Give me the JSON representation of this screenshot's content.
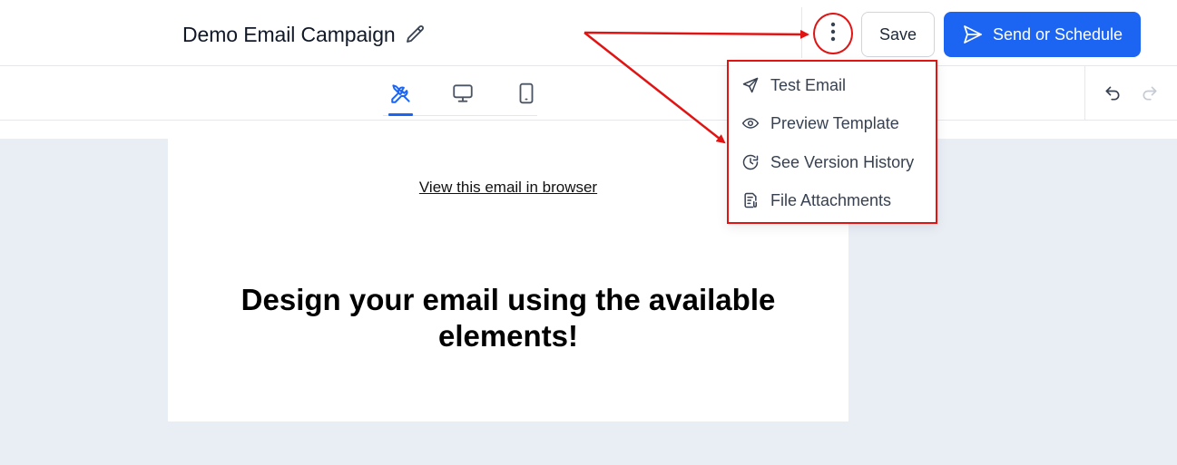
{
  "header": {
    "campaign_title": "Demo Email Campaign",
    "save_label": "Save",
    "send_label": "Send or Schedule",
    "accent_color": "#1c64f2"
  },
  "toolbar": {
    "tabs": [
      {
        "name": "design",
        "icon": "tools-icon",
        "active": true
      },
      {
        "name": "desktop-preview",
        "icon": "monitor-icon",
        "active": false
      },
      {
        "name": "mobile-preview",
        "icon": "mobile-icon",
        "active": false
      }
    ],
    "undo_icon": "undo-icon",
    "redo_icon": "redo-icon"
  },
  "email": {
    "view_in_browser_label": "View this email in browser",
    "headline": "Design your email using the available elements!"
  },
  "menu": {
    "items": [
      {
        "label": "Test Email",
        "icon": "send-icon"
      },
      {
        "label": "Preview Template",
        "icon": "eye-icon"
      },
      {
        "label": "See Version History",
        "icon": "history-icon"
      },
      {
        "label": "File Attachments",
        "icon": "attachment-file-icon"
      }
    ]
  },
  "annotation": {
    "highlight_color": "#e11414"
  }
}
